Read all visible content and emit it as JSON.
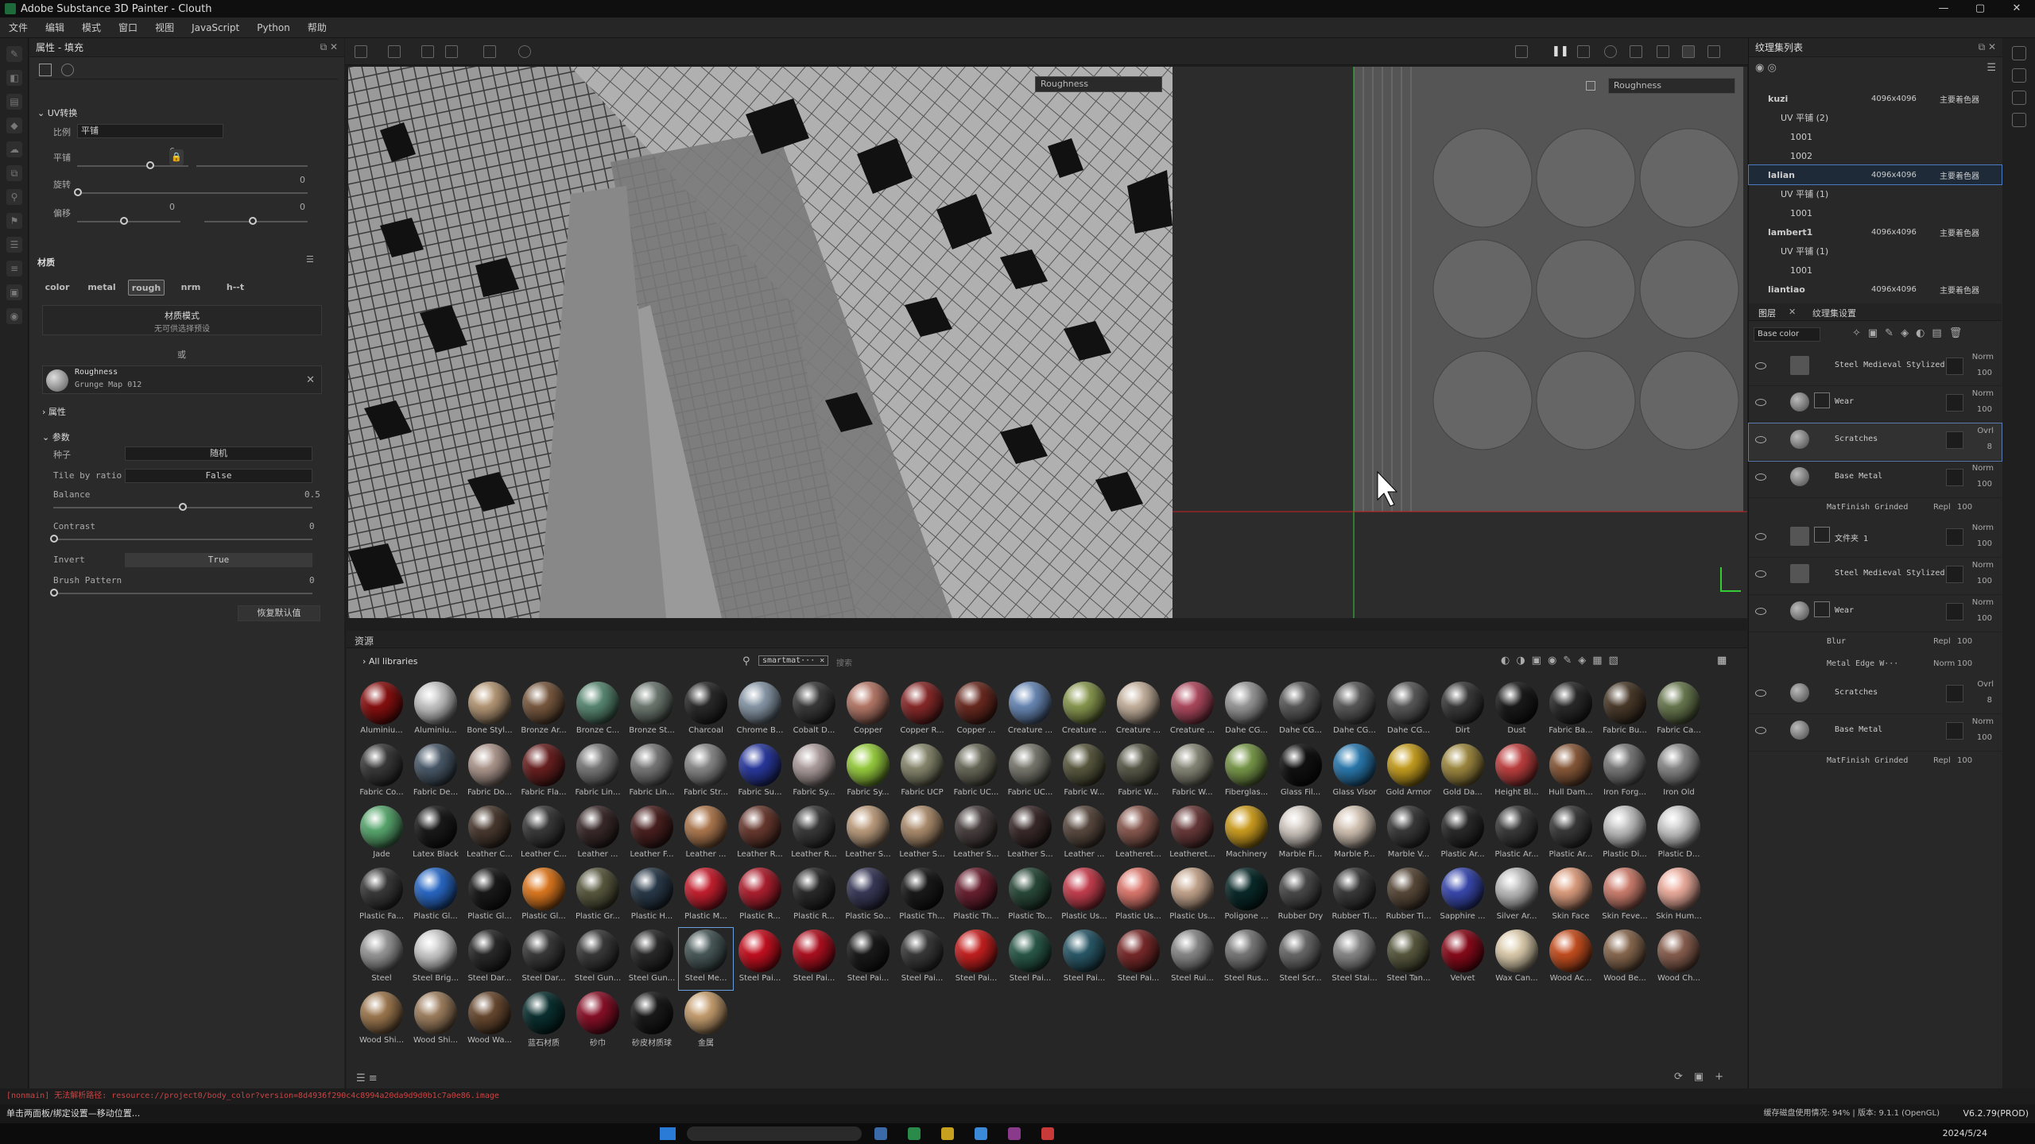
{
  "window": {
    "title": "Adobe Substance 3D Painter - Clouth",
    "controls": [
      "—",
      "▢",
      "✕"
    ]
  },
  "menu": [
    "文件",
    "编辑",
    "模式",
    "窗口",
    "视图",
    "JavaScript",
    "Python",
    "帮助"
  ],
  "props": {
    "panel_title": "属性 - 填充",
    "uv_section": "UV转换",
    "scale_label": "比例",
    "scale_value": "平铺",
    "tile_label": "平铺",
    "tile_value": "6",
    "rotate_label": "旋转",
    "rotate_value": "0",
    "offset_label": "偏移",
    "offset_value": "0",
    "offset_value2": "0",
    "material_section": "材质",
    "channels": [
      "color",
      "metal",
      "rough",
      "nrm",
      "h--t"
    ],
    "material_mode_title": "材质模式",
    "material_mode_sub": "无可供选择预设",
    "or_label": "或",
    "resource_name": "Roughness",
    "resource_sub": "Grunge Map 012",
    "attributes_label": "属性",
    "params_label": "参数",
    "seed_label": "种子",
    "seed_value": "随机",
    "tile_by_ratio_label": "Tile by ratio",
    "tile_by_ratio_value": "False",
    "balance_label": "Balance",
    "balance_value": "0.5",
    "contrast_label": "Contrast",
    "contrast_value": "0",
    "invert_label": "Invert",
    "invert_value": "True",
    "brush_pattern_label": "Brush Pattern",
    "brush_pattern_value": "0",
    "reset_label": "恢复默认值"
  },
  "viewport": {
    "channel_3d": "Roughness",
    "channel_2d": "Roughness"
  },
  "shelf": {
    "title": "资源",
    "library": "All libraries",
    "search_tag": "smartmat··· ✕",
    "search_placeholder": "搜索",
    "materials": [
      "Aluminiu...",
      "Aluminiu...",
      "Bone Styl...",
      "Bronze Ar...",
      "Bronze C...",
      "Bronze St...",
      "Charcoal",
      "Chrome B...",
      "Cobalt D...",
      "Copper",
      "Copper R...",
      "Copper ...",
      "Creature ...",
      "Creature ...",
      "Creature ...",
      "Creature ...",
      "Dahe CG...",
      "Dahe CG...",
      "Dahe CG...",
      "Dahe CG...",
      "Dirt",
      "Dust",
      "Fabric Ba...",
      "Fabric Bu...",
      "Fabric Ca...",
      "Fabric Co...",
      "Fabric De...",
      "Fabric Do...",
      "Fabric Fla...",
      "Fabric Lin...",
      "Fabric Lin...",
      "Fabric Str...",
      "Fabric Su...",
      "Fabric Sy...",
      "Fabric Sy...",
      "Fabric UCP",
      "Fabric UC...",
      "Fabric UC...",
      "Fabric W...",
      "Fabric W...",
      "Fabric W...",
      "Fiberglas...",
      "Glass Fil...",
      "Glass Visor",
      "Gold Armor",
      "Gold Da...",
      "Height Bl...",
      "Hull Dam...",
      "Iron Forg...",
      "Iron Old",
      "Jade",
      "Latex Black",
      "Leather C...",
      "Leather C...",
      "Leather ...",
      "Leather F...",
      "Leather ...",
      "Leather R...",
      "Leather R...",
      "Leather S...",
      "Leather S...",
      "Leather S...",
      "Leather S...",
      "Leather ...",
      "Leatheret...",
      "Leatheret...",
      "Machinery",
      "Marble Fi...",
      "Marble P...",
      "Marble V...",
      "Plastic Ar...",
      "Plastic Ar...",
      "Plastic Ar...",
      "Plastic Di...",
      "Plastic D...",
      "Plastic Fa...",
      "Plastic Gl...",
      "Plastic Gl...",
      "Plastic Gl...",
      "Plastic Gr...",
      "Plastic H...",
      "Plastic M...",
      "Plastic R...",
      "Plastic R...",
      "Plastic So...",
      "Plastic Th...",
      "Plastic Th...",
      "Plastic To...",
      "Plastic Us...",
      "Plastic Us...",
      "Plastic Us...",
      "Poligone ...",
      "Rubber Dry",
      "Rubber Ti...",
      "Rubber Ti...",
      "Sapphire ...",
      "Silver Ar...",
      "Skin Face",
      "Skin Feve...",
      "Skin Hum...",
      "Steel",
      "Steel Brig...",
      "Steel Dar...",
      "Steel Dar...",
      "Steel Gun...",
      "Steel Gun...",
      "Steel Me...",
      "Steel Pai...",
      "Steel Pai...",
      "Steel Pai...",
      "Steel Pai...",
      "Steel Pai...",
      "Steel Pai...",
      "Steel Pai...",
      "Steel Pai...",
      "Steel Rui...",
      "Steel Rus...",
      "Steel Scr...",
      "Steel Stai...",
      "Steel Tan...",
      "Velvet",
      "Wax Can...",
      "Wood Ac...",
      "Wood Be...",
      "Wood Ch...",
      "Wood Shi...",
      "Wood Shi...",
      "Wood Wa...",
      "蓝石材质",
      "砂巾",
      "砂皮材质球",
      "金属"
    ]
  },
  "colors": [
    "#8a1010",
    "#c8c8c8",
    "#b89a78",
    "#7a5a40",
    "#5a8a74",
    "#6e7a72",
    "#2a2a2a",
    "#8a9aaa",
    "#3a3a3a",
    "#b87a6a",
    "#8a2a2a",
    "#6a2a20",
    "#6a8ab8",
    "#8a9a50",
    "#c8b4a0",
    "#b04a60",
    "#9a9a9a",
    "#5a5a5a",
    "#5a5a5a",
    "#5a5a5a",
    "#3a3a3a",
    "#1a1a1a",
    "#2a2a2a",
    "#4a3a2a",
    "#6a7a50",
    "#3a3a3a",
    "#4a5a6a",
    "#b09a90",
    "#6a2020",
    "#7a7a7a",
    "#7a7a7a",
    "#8a8a8a",
    "#2a3aa0",
    "#b0a0a0",
    "#9ad040",
    "#8a8a70",
    "#6a6a5a",
    "#7a7a70",
    "#5a5a40",
    "#5a5a4a",
    "#8a8a7a",
    "#7a9a4a",
    "#111111",
    "#2a7ab0",
    "#c8a020",
    "#a08a40",
    "#c04040",
    "#8a5a3a",
    "#7a7a7a",
    "#8a8a8a",
    "#5aaa70",
    "#1a1a1a",
    "#4a3a30",
    "#3a3a3a",
    "#3a2a2a",
    "#4a2020",
    "#b07a50",
    "#6a3a30",
    "#3a3a3a",
    "#c0a080",
    "#b09070",
    "#4a4040",
    "#3a2a2a",
    "#5a4a40",
    "#8a5a50",
    "#6a3a3a",
    "#d0a020",
    "#d8d0c8",
    "#d8c8b8",
    "#3a3a3a",
    "#2a2a2a",
    "#3a3a3a",
    "#3a3a3a",
    "#c8c8c8",
    "#d0d0d0",
    "#3a3a3a",
    "#2a6ac8",
    "#1a1a1a",
    "#e07a20",
    "#5a5a40",
    "#2a3a4a",
    "#c82030",
    "#b02030",
    "#2a2a2a",
    "#3a3a5a",
    "#1a1a1a",
    "#6a2030",
    "#2a4a3a",
    "#c84050",
    "#e07a70",
    "#c8a890",
    "#0a2a2a",
    "#4a4a4a",
    "#3a3a3a",
    "#5a4a3a",
    "#3a4ab0",
    "#c0c0c0",
    "#e0a080",
    "#d08070",
    "#f0b0a0",
    "#9a9a9a",
    "#d0d0d0",
    "#2a2a2a",
    "#3a3a3a",
    "#3a3a3a",
    "#2a2a2a",
    "#4a5a5a",
    "#c81020",
    "#b01020",
    "#1a1a1a",
    "#3a3a3a",
    "#c82020",
    "#2a5a4a",
    "#2a5a6a",
    "#7a2a2a",
    "#8a8a8a",
    "#7a7a7a",
    "#6a6a6a",
    "#8a8a8a",
    "#5a5a40",
    "#8a0a1a",
    "#e0d0b0",
    "#c85020",
    "#8a6a50",
    "#8a6050",
    "#a07a50",
    "#a08060",
    "#6a4a30",
    "#0a3030",
    "#8a1028",
    "#1a1a1a",
    "#c8a070"
  ],
  "texset": {
    "title": "纹理集列表",
    "items": [
      {
        "name": "kuzi",
        "res": "4096x4096",
        "shader": "主要着色器"
      },
      {
        "name": "UV 平铺 (2)",
        "sub": true
      },
      {
        "name": "1001",
        "tile": true
      },
      {
        "name": "1002",
        "tile": true
      },
      {
        "name": "lalian",
        "res": "4096x4096",
        "shader": "主要着色器",
        "selected": true
      },
      {
        "name": "UV 平铺 (1)",
        "sub": true
      },
      {
        "name": "1001",
        "tile": true
      },
      {
        "name": "lambert1",
        "res": "4096x4096",
        "shader": "主要着色器"
      },
      {
        "name": "UV 平铺 (1)",
        "sub": true
      },
      {
        "name": "1001",
        "tile": true
      },
      {
        "name": "liantiao",
        "res": "4096x4096",
        "shader": "主要着色器"
      }
    ]
  },
  "layers": {
    "tab1": "图层",
    "tab2": "纹理集设置",
    "channel": "Base color",
    "items": [
      {
        "name": "Steel Medieval Stylized",
        "blend": "Norm",
        "op": "100",
        "folder": true
      },
      {
        "name": "Wear",
        "blend": "Norm",
        "op": "100",
        "mask": true
      },
      {
        "name": "Scratches",
        "blend": "Ovrl",
        "op": "8",
        "selected": true
      },
      {
        "name": "Base Metal",
        "blend": "Norm",
        "op": "100"
      },
      {
        "name": "MatFinish Grinded",
        "blend": "Repl",
        "op": "100",
        "effect": true
      },
      {
        "name": "文件夹 1",
        "blend": "Norm",
        "op": "100",
        "folder": true,
        "mask": true
      },
      {
        "name": "Steel Medieval Stylized",
        "blend": "Norm",
        "op": "100",
        "folder": true
      },
      {
        "name": "Wear",
        "blend": "Norm",
        "op": "100",
        "mask": true
      },
      {
        "name": "Blur",
        "blend": "Repl",
        "op": "100",
        "effect": true
      },
      {
        "name": "Metal Edge W···",
        "blend": "Norm",
        "op": "100",
        "effect": true
      },
      {
        "name": "Scratches",
        "blend": "Ovrl",
        "op": "8"
      },
      {
        "name": "Base Metal",
        "blend": "Norm",
        "op": "100"
      },
      {
        "name": "MatFinish Grinded",
        "blend": "Repl",
        "op": "100",
        "effect": true
      }
    ]
  },
  "status": {
    "error": "[nonmain] 无法解析路径: resource://project0/body_color?version=8d4936f290c4c8994a20da9d9d0b1c7a0e86.image",
    "cache": "缓存磁盘使用情况:  94%  |  版本: 9.1.1 (OpenGL)",
    "version": "V6.2.79(PROD)",
    "left_msg": "单击两面板/绑定设置—移动位置...",
    "datetime": "2024/5/24"
  }
}
